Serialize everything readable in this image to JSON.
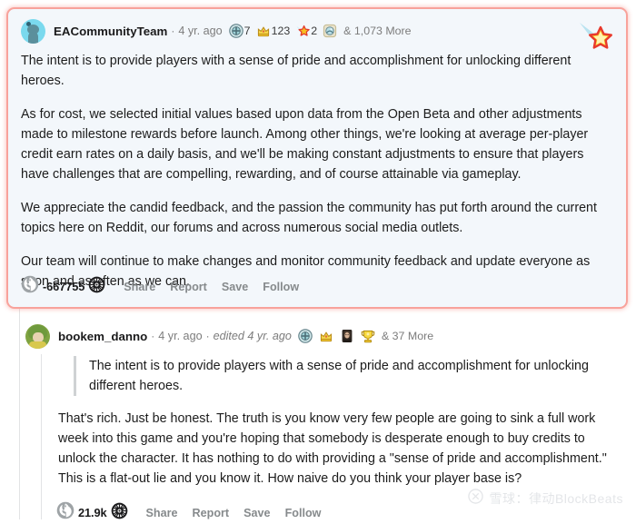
{
  "comments": [
    {
      "id": "comment-ea",
      "username": "EACommunityTeam",
      "separator": "·",
      "timestamp": "4 yr. ago",
      "awards": [
        {
          "name": "platinum-award-icon",
          "count": "7"
        },
        {
          "name": "gold-crown-award-icon",
          "count": "123"
        },
        {
          "name": "red-star-award-icon",
          "count": "2"
        },
        {
          "name": "silver-award-icon",
          "count": ""
        }
      ],
      "awards_more": "& 1,073 More",
      "paragraphs": [
        "The intent is to provide players with a sense of pride and accomplishment for unlocking different heroes.",
        "As for cost, we selected initial values based upon data from the Open Beta and other adjustments made to milestone rewards before launch. Among other things, we're looking at average per-player credit earn rates on a daily basis, and we'll be making constant adjustments to ensure that players have challenges that are compelling, rewarding, and of course attainable via gameplay.",
        "We appreciate the candid feedback, and the passion the community has put forth around the current topics here on Reddit, our forums and across numerous social media outlets.",
        "Our team will continue to make changes and monitor community feedback and update everyone as soon and as often as we can."
      ],
      "score": "-667755",
      "actions": [
        "Share",
        "Report",
        "Save",
        "Follow"
      ]
    },
    {
      "id": "comment-bookem",
      "username": "bookem_danno",
      "separator": "·",
      "timestamp": "4 yr. ago",
      "edited": "edited 4 yr. ago",
      "awards": [
        {
          "name": "platinum-award-icon",
          "count": ""
        },
        {
          "name": "gold-crown-award-icon",
          "count": ""
        },
        {
          "name": "dark-avatar-award-icon",
          "count": ""
        },
        {
          "name": "gold-trophy-award-icon",
          "count": ""
        }
      ],
      "awards_more": "& 37 More",
      "quote": "The intent is to provide players with a sense of pride and accomplishment for unlocking different heroes.",
      "body": "That's rich. Just be honest. The truth is you know very few people are going to sink a full work week into this game and you're hoping that somebody is desperate enough to buy credits to unlock the character. It has nothing to do with providing a \"sense of pride and accomplishment.\" This is a flat-out lie and you know it. How naive do you think your player base is?",
      "score": "21.9k",
      "actions": [
        "Share",
        "Report",
        "Save",
        "Follow"
      ]
    }
  ],
  "top_award": {
    "name": "shooting-star-award-icon"
  },
  "watermark": {
    "text": "雪球：律动BlockBeats"
  },
  "colors": {
    "highlight_bg": "#f3f7fb",
    "highlight_border": "#f8a29b",
    "muted_text": "#7c7c7c",
    "action_text": "#868a8c"
  }
}
